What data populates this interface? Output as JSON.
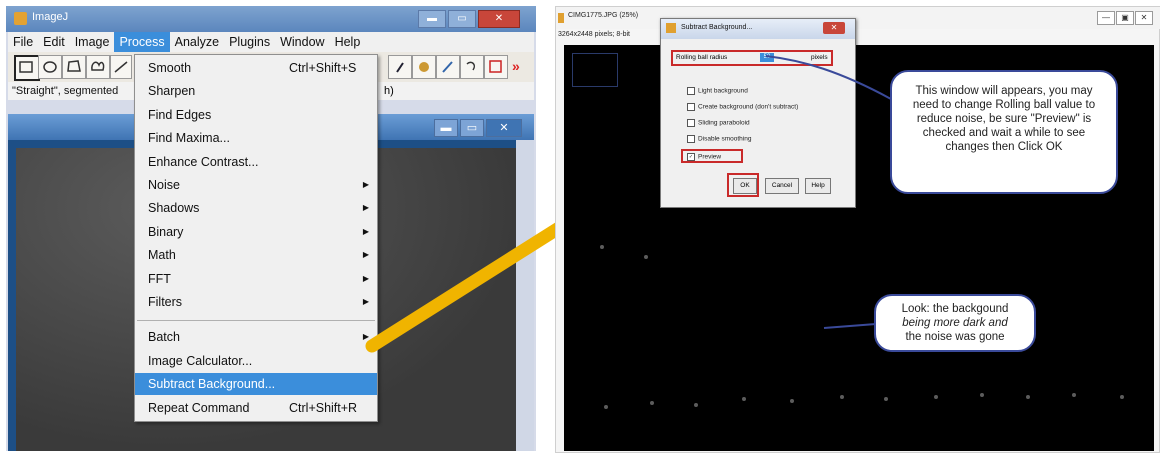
{
  "ij": {
    "title": "ImageJ",
    "menus": [
      "File",
      "Edit",
      "Image",
      "Process",
      "Analyze",
      "Plugins",
      "Window",
      "Help"
    ],
    "active_menu": "Process",
    "status_text": "\"Straight\", segmented",
    "status_right": "h)",
    "minimize": "▬",
    "maximize": "▭",
    "close": "✕"
  },
  "image_window": {
    "minimize": "▬",
    "maximize": "▭",
    "close": "✕"
  },
  "process_menu": {
    "items": [
      {
        "label": "Smooth",
        "shortcut": "Ctrl+Shift+S",
        "submenu": false
      },
      {
        "label": "Sharpen",
        "shortcut": "",
        "submenu": false
      },
      {
        "label": "Find Edges",
        "shortcut": "",
        "submenu": false
      },
      {
        "label": "Find Maxima...",
        "shortcut": "",
        "submenu": false
      },
      {
        "label": "Enhance Contrast...",
        "shortcut": "",
        "submenu": false
      },
      {
        "label": "Noise",
        "shortcut": "",
        "submenu": true
      },
      {
        "label": "Shadows",
        "shortcut": "",
        "submenu": true
      },
      {
        "label": "Binary",
        "shortcut": "",
        "submenu": true
      },
      {
        "label": "Math",
        "shortcut": "",
        "submenu": true
      },
      {
        "label": "FFT",
        "shortcut": "",
        "submenu": true
      },
      {
        "label": "Filters",
        "shortcut": "",
        "submenu": true
      },
      {
        "label": "Batch",
        "shortcut": "",
        "submenu": true
      },
      {
        "label": "Image Calculator...",
        "shortcut": "",
        "submenu": false
      },
      {
        "label": "Subtract Background...",
        "shortcut": "",
        "submenu": false
      },
      {
        "label": "Repeat Command",
        "shortcut": "Ctrl+Shift+R",
        "submenu": false
      }
    ],
    "highlighted": "Subtract Background...",
    "arrow_glyph": "▶"
  },
  "right_window": {
    "title": "CIMG1775.JPG (25%)",
    "info": "3264x2448 pixels; 8-bit",
    "buttons": [
      "—",
      "▣",
      "✕"
    ]
  },
  "dialog": {
    "title": "Subtract Background...",
    "close": "✕",
    "rolling_ball_label": "Rolling ball radius",
    "rolling_ball_value": "50",
    "rolling_ball_unit": "pixels",
    "checkboxes": [
      {
        "label": "Light background",
        "checked": false
      },
      {
        "label": "Create background (don't subtract)",
        "checked": false
      },
      {
        "label": "Sliding paraboloid",
        "checked": false
      },
      {
        "label": "Disable smoothing",
        "checked": false
      },
      {
        "label": "Preview",
        "checked": true
      }
    ],
    "ok": "OK",
    "cancel": "Cancel",
    "help": "Help"
  },
  "callout_top": {
    "text": "This window will appears, you may need to change Rolling ball value to reduce noise, be sure \"Preview\" is checked and wait a while to see changes then Click OK"
  },
  "callout_bottom": {
    "line1": "Look: the backgound",
    "line2": "being more dark and",
    "line3": "the noise was gone"
  },
  "colors": {
    "accent_arrow": "#f0b400",
    "highlight": "#3b8edb",
    "red_box": "#c92a2a"
  }
}
